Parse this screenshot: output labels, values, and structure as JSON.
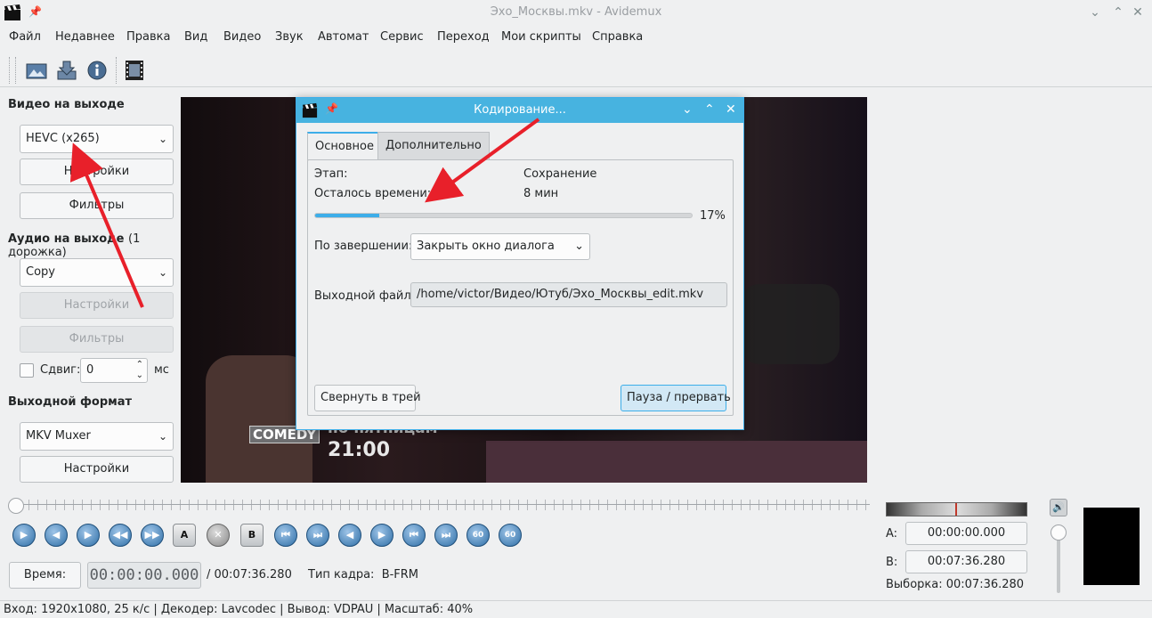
{
  "window": {
    "title": "Эхо_Москвы.mkv - Avidemux"
  },
  "menu": [
    "Файл",
    "Недавнее",
    "Правка",
    "Вид",
    "Видео",
    "Звук",
    "Автомат",
    "Сервис",
    "Переход",
    "Мои скрипты",
    "Справка"
  ],
  "left": {
    "video_title": "Видео на выходе",
    "video_codec": "HEVC (x265)",
    "settings": "Настройки",
    "filters": "Фильтры",
    "audio_title": "Аудио на выходе",
    "audio_tracks": "(1 дорожка)",
    "audio_codec": "Copy",
    "shift_label": "Сдвиг:",
    "shift_value": "0",
    "shift_unit": "мс",
    "format_title": "Выходной формат",
    "format_value": "MKV Muxer"
  },
  "overlay": {
    "logo": "COMEDY",
    "line1": "по пятницам",
    "line2": "21:00"
  },
  "dialog": {
    "title": "Кодирование...",
    "tab_main": "Основное",
    "tab_extra": "Дополнительно",
    "stage_label": "Этап:",
    "stage_value": "Сохранение",
    "remaining_label": "Осталось времени:",
    "remaining_value": "8 мин",
    "progress_percent": 17,
    "progress_text": "17%",
    "on_finish_label": "По завершении:",
    "on_finish_value": "Закрыть окно диалога",
    "output_label": "Выходной файл:",
    "output_value": "/home/victor/Видео/Ютуб/Эхо_Москвы_edit.mkv",
    "btn_tray": "Свернуть в трей",
    "btn_pause": "Пауза / прервать"
  },
  "bottom": {
    "time_button": "Время:",
    "current_time": "00:00:00.000",
    "total_time": "/ 00:07:36.280",
    "frame_type": "Тип кадра:  B-FRM",
    "a_label": "A:",
    "a_value": "00:00:00.000",
    "b_label": "B:",
    "b_value": "00:07:36.280",
    "selection": "Выборка: 00:07:36.280"
  },
  "status": "Вход: 1920x1080, 25 к/с  |  Декодер: Lavcodec  |  Вывод: VDPAU  |  Масштаб: 40%",
  "nav_labels": {
    "a": "A",
    "b": "B",
    "sixty": "60"
  },
  "colors": {
    "accent": "#3daee9",
    "arrow": "#e8202a"
  }
}
